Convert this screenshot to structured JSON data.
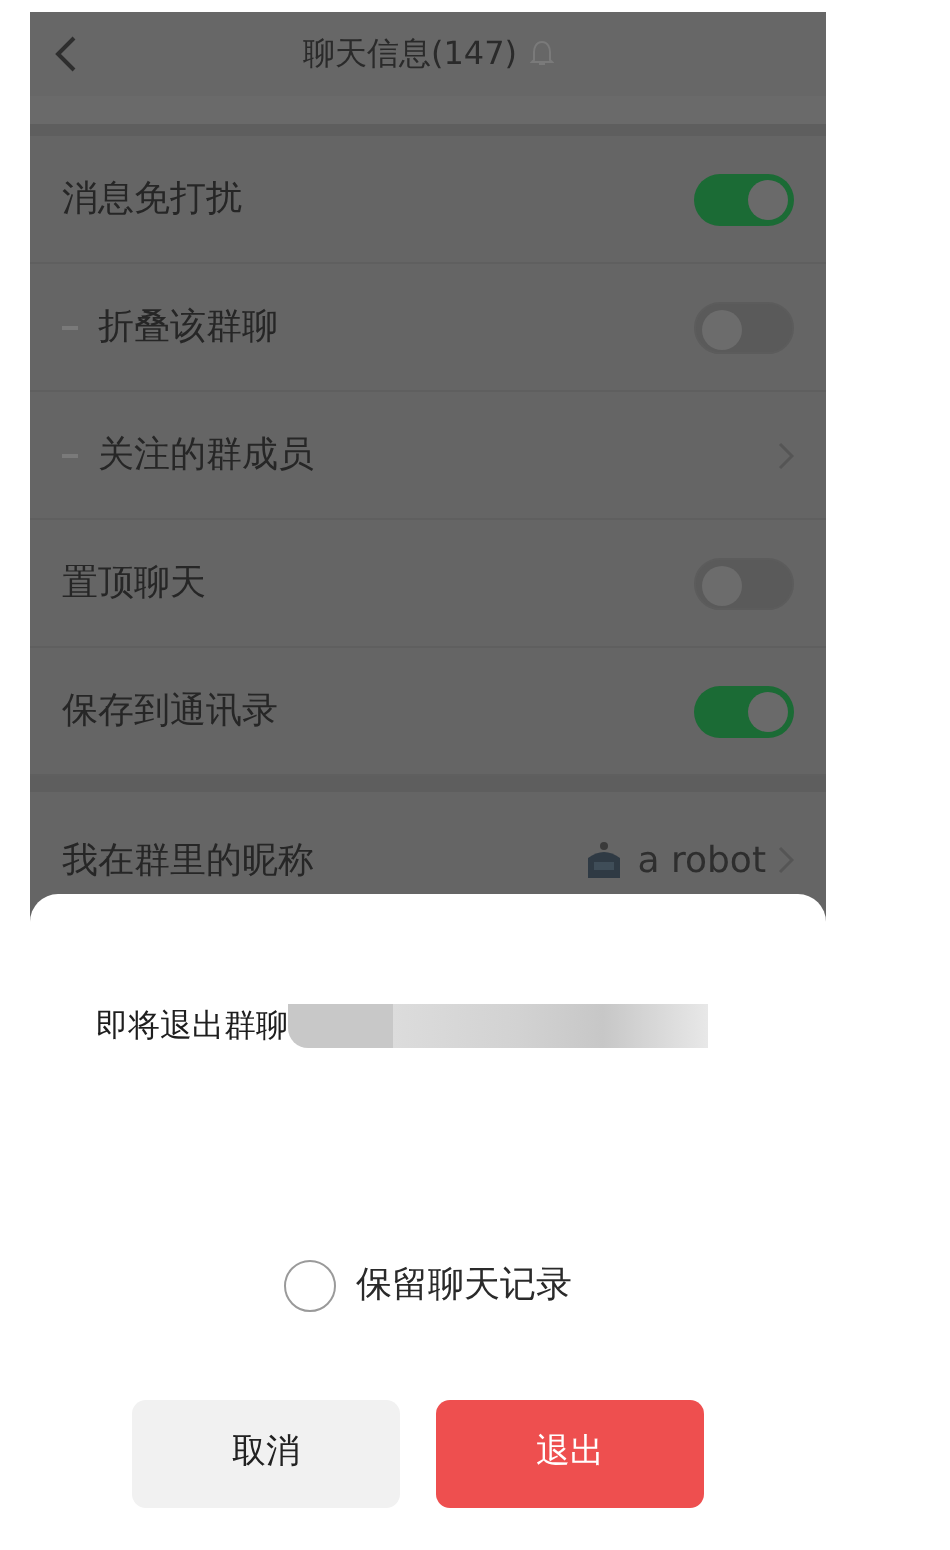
{
  "header": {
    "title": "聊天信息(147)"
  },
  "settings": [
    {
      "kind": "toggle",
      "label": "消息免打扰",
      "indented": false,
      "on": true
    },
    {
      "kind": "toggle",
      "label": "折叠该群聊",
      "indented": true,
      "on": false
    },
    {
      "kind": "link",
      "label": "关注的群成员",
      "indented": true
    },
    {
      "kind": "toggle",
      "label": "置顶聊天",
      "indented": false,
      "on": false
    },
    {
      "kind": "toggle",
      "label": "保存到通讯录",
      "indented": false,
      "on": true
    },
    {
      "kind": "nickname",
      "label": "我在群里的昵称",
      "indented": false,
      "value": "a robot"
    }
  ],
  "dialog": {
    "message": "即将退出群聊",
    "option": {
      "label": "保留聊天记录",
      "checked": false
    },
    "buttons": [
      {
        "kind": "cancel",
        "label": "取消"
      },
      {
        "kind": "danger",
        "label": "退出"
      }
    ]
  }
}
